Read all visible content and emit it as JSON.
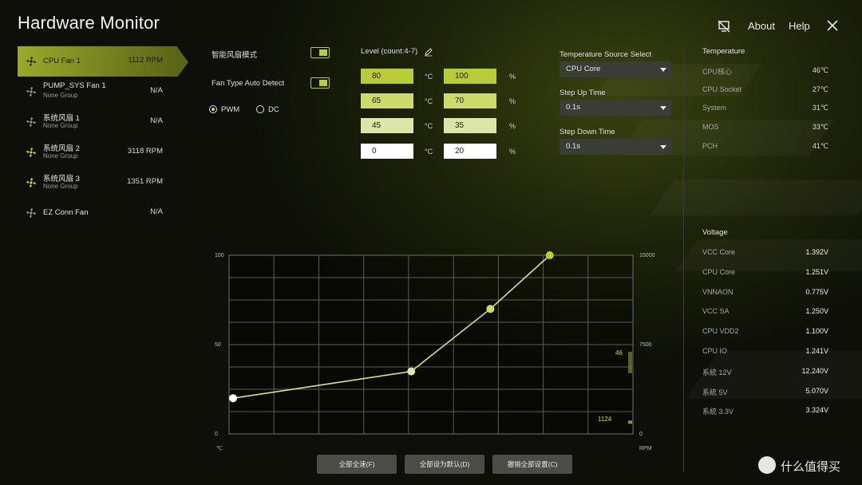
{
  "app": {
    "title": "Hardware Monitor"
  },
  "topnav": {
    "about": "About",
    "help": "Help"
  },
  "fans": [
    {
      "name": "CPU Fan 1",
      "group": "",
      "value": "1112 RPM",
      "selected": true,
      "icon": "fan-icon"
    },
    {
      "name": "PUMP_SYS Fan 1",
      "group": "None Group",
      "value": "N/A",
      "icon": "pump-icon"
    },
    {
      "name": "系统风扇 1",
      "group": "None Group",
      "value": "N/A",
      "icon": "fan-icon"
    },
    {
      "name": "系统风扇 2",
      "group": "None Group",
      "value": "3118 RPM",
      "icon": "fan-icon"
    },
    {
      "name": "系统风扇 3",
      "group": "None Group",
      "value": "1351 RPM",
      "icon": "fan-icon"
    },
    {
      "name": "EZ Conn Fan",
      "group": "",
      "value": "N/A",
      "icon": "ez-conn-icon"
    }
  ],
  "controls": {
    "smart_mode": "智能风扇模式",
    "auto_detect": "Fan Type Auto Detect",
    "pwm": "PWM",
    "dc": "DC",
    "level_label": "Level (count:4-7)"
  },
  "levels": [
    {
      "temp": "80",
      "speed": "100"
    },
    {
      "temp": "65",
      "speed": "70"
    },
    {
      "temp": "45",
      "speed": "35"
    },
    {
      "temp": "0",
      "speed": "20"
    }
  ],
  "units": {
    "temp": "°C",
    "pct": "%"
  },
  "temp_source": {
    "label": "Temperature Source Select",
    "value": "CPU Core"
  },
  "step_up": {
    "label": "Step Up Time",
    "value": "0.1s"
  },
  "step_down": {
    "label": "Step Down Time",
    "value": "0.1s"
  },
  "temperature": {
    "title": "Temperature",
    "items": [
      {
        "label": "CPU核心",
        "value": "46℃"
      },
      {
        "label": "CPU Socket",
        "value": "27℃"
      },
      {
        "label": "System",
        "value": "31℃"
      },
      {
        "label": "MOS",
        "value": "33℃"
      },
      {
        "label": "PCH",
        "value": "41℃"
      }
    ]
  },
  "voltage": {
    "title": "Voltage",
    "items": [
      {
        "label": "VCC Core",
        "value": "1.392V"
      },
      {
        "label": "CPU Core",
        "value": "1.251V"
      },
      {
        "label": "VNNAON",
        "value": "0.775V"
      },
      {
        "label": "VCC SA",
        "value": "1.250V"
      },
      {
        "label": "CPU VDD2",
        "value": "1.100V"
      },
      {
        "label": "CPU IO",
        "value": "1.241V"
      },
      {
        "label": "系統 12V",
        "value": "12.240V"
      },
      {
        "label": "系統 5V",
        "value": "5.070V"
      },
      {
        "label": "系統 3.3V",
        "value": "3.324V"
      }
    ]
  },
  "buttons": {
    "full_speed": "全部全速(F)",
    "default": "全部设为默认(D)",
    "cancel": "撤销全部设置(C)"
  },
  "chart_axes": {
    "y_left": [
      "100",
      "50",
      "0"
    ],
    "y_right": [
      "15000",
      "7500",
      "0"
    ],
    "x_unit": "℃",
    "right_unit": "RPM",
    "current_temp": "46",
    "current_rpm": "1124"
  },
  "chart_data": {
    "type": "line",
    "xlabel": "℃",
    "ylabel": "",
    "xlim": [
      0,
      100
    ],
    "ylim": [
      0,
      100
    ],
    "y2lim": [
      0,
      15000
    ],
    "series": [
      {
        "x": [
          0,
          45,
          65,
          80
        ],
        "y": [
          20,
          35,
          70,
          100
        ]
      }
    ],
    "markers": {
      "current_temp": 46,
      "current_rpm": 1124
    }
  },
  "colors": {
    "accent": "#c5d74d",
    "panel": "#4a4c46"
  },
  "watermark": "值 什么值得买"
}
